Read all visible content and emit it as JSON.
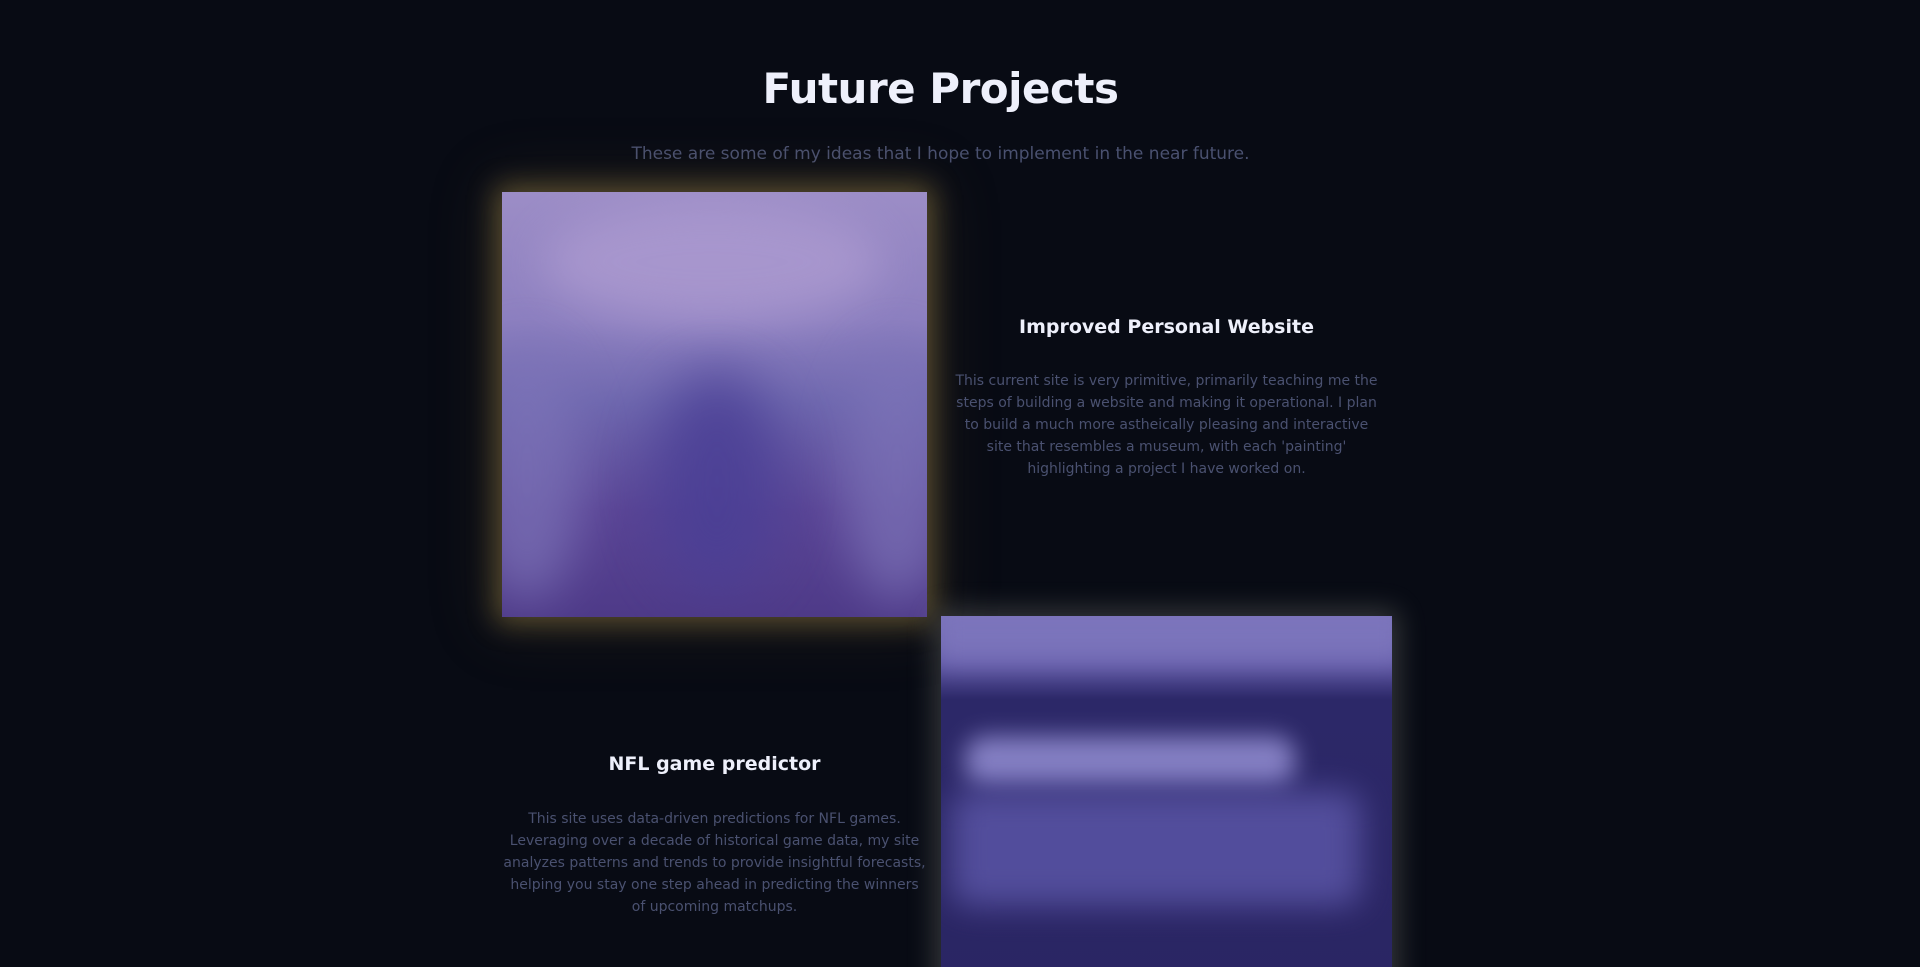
{
  "section": {
    "title": "Future Projects",
    "subtitle": "These are some of my ideas that I hope to implement in the near future."
  },
  "projects": [
    {
      "title": "Improved Personal Website",
      "description": "This current site is very primitive, primarily teaching me the steps of building a website and making it operational. I plan to build a much more astheically pleasing and interactive site that resembles a museum, with each 'painting' highlighting a project I have worked on."
    },
    {
      "title": "NFL game predictor",
      "description": "This site uses data-driven predictions for NFL games. Leveraging over a decade of historical game data, my site analyzes patterns and trends to provide insightful forecasts, helping you stay one step ahead in predicting the winners of upcoming matchups."
    }
  ],
  "colors": {
    "background": "#080b14",
    "heading": "#eef0fb",
    "muted_text": "#4a5170",
    "glow_gold": "#ceAd58",
    "image_purple": "#6e67ae"
  }
}
